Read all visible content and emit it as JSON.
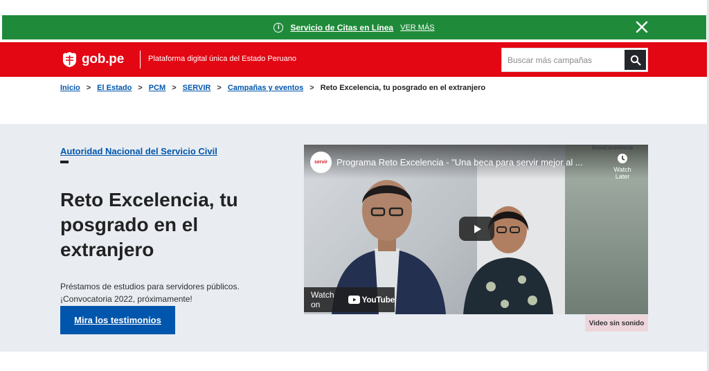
{
  "notice": {
    "text": "Servicio de Citas en Línea",
    "link": "VER MÁS",
    "icons": {
      "info": "info-icon",
      "close": "close-icon"
    },
    "color": "#1f8b3a"
  },
  "header": {
    "logo_text": "gob.pe",
    "tagline": "Plataforma digital única del Estado Peruano",
    "search_placeholder": "Buscar más campañas",
    "color": "#e30613",
    "icons": {
      "logo": "peru-crest-icon",
      "search": "search-icon"
    }
  },
  "breadcrumb": {
    "items": [
      "Inicio",
      "El Estado",
      "PCM",
      "SERVIR",
      "Campañas y eventos"
    ],
    "current": "Reto Excelencia, tu posgrado en el extranjero",
    "separator": ">"
  },
  "hero": {
    "entity": "Autoridad Nacional del Servicio Civil",
    "title": "Reto Excelencia, tu posgrado en el extranjero",
    "description_line1": "Préstamos de estudios para servidores públicos.",
    "description_line2": "¡Convocatoria 2022, próximamente!",
    "cta": "Mira los testimonios",
    "background": "#e9edf2",
    "accent": "#0056ac"
  },
  "video": {
    "channel_label": "servir",
    "title": "Programa Reto Excelencia - \"Una beca para servir mejor al ...",
    "watch_later": "Watch Later",
    "brand_tag": "RetoExcelencia",
    "watch_on": "Watch on",
    "youtube": "YouTube",
    "muted_label": "Video sin sonido",
    "icons": {
      "play": "play-icon",
      "clock": "clock-icon",
      "youtube": "youtube-icon"
    }
  }
}
